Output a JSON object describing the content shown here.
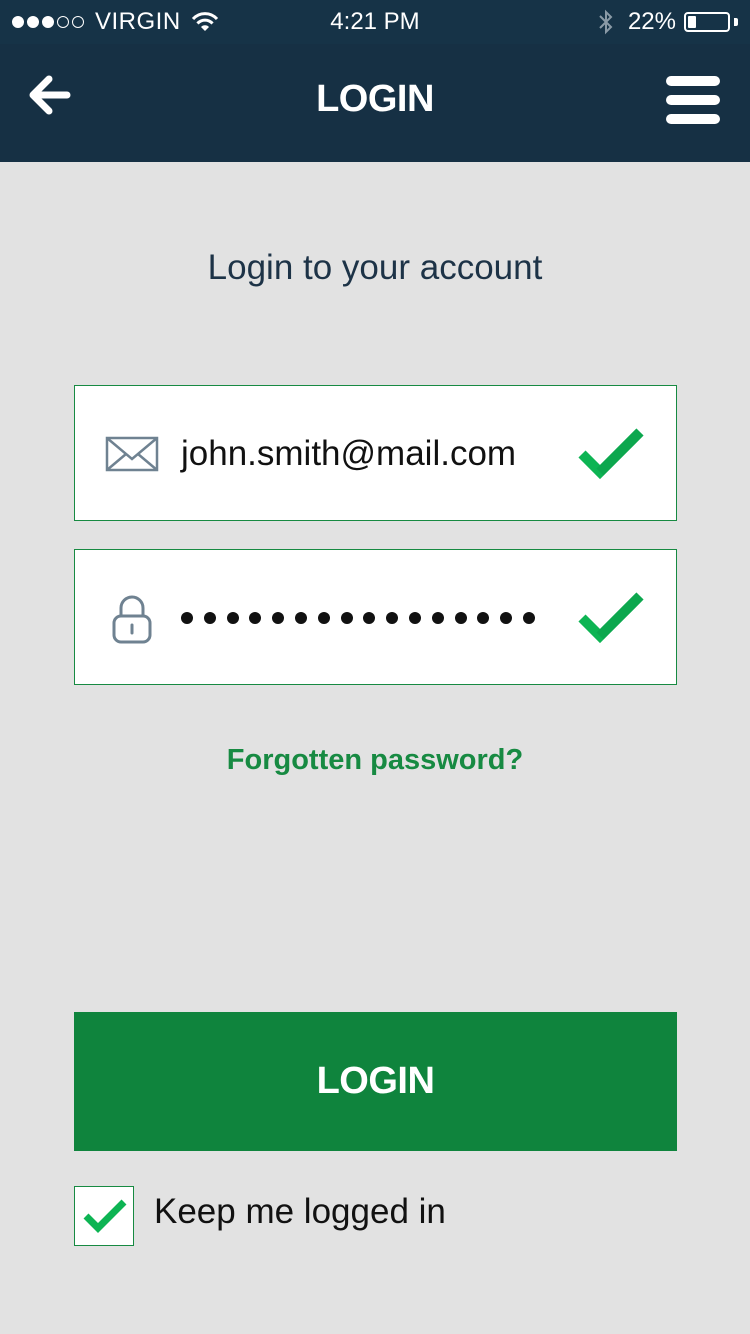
{
  "status_bar": {
    "signal_filled": 3,
    "signal_total": 5,
    "carrier": "VIRGIN",
    "time": "4:21 PM",
    "battery_percent_text": "22%",
    "battery_level": 0.22
  },
  "nav": {
    "title": "LOGIN",
    "back_icon": "arrow-left-icon",
    "menu_icon": "hamburger-icon"
  },
  "form": {
    "subtitle": "Login to your account",
    "email": {
      "value": "john.smith@mail.com",
      "icon": "envelope-icon",
      "valid": true
    },
    "password": {
      "masked_length": 16,
      "icon": "lock-icon",
      "valid": true
    },
    "forgot_link": "Forgotten password?",
    "submit_label": "LOGIN",
    "keep_logged_in": {
      "label": "Keep me logged in",
      "checked": true
    }
  },
  "colors": {
    "header_bg": "#163044",
    "page_bg": "#e2e2e2",
    "accent_green": "#0f843d",
    "check_green": "#0db453"
  }
}
